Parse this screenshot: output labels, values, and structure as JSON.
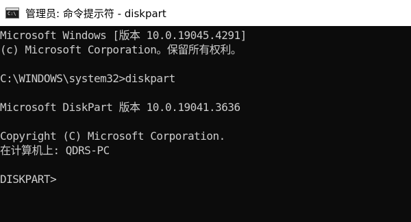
{
  "window": {
    "title": "管理员: 命令提示符 - diskpart",
    "icon": "cmd-console-icon",
    "icon_glyph": "C:\\"
  },
  "console": {
    "lines": [
      "Microsoft Windows [版本 10.0.19045.4291]",
      "(c) Microsoft Corporation。保留所有权利。",
      "",
      "C:\\WINDOWS\\system32>diskpart",
      "",
      "Microsoft DiskPart 版本 10.0.19041.3636",
      "",
      "Copyright (C) Microsoft Corporation.",
      "在计算机上: QDRS-PC",
      "",
      "DISKPART>"
    ],
    "text_color": "#cccccc",
    "background_color": "#0c0c0c"
  }
}
